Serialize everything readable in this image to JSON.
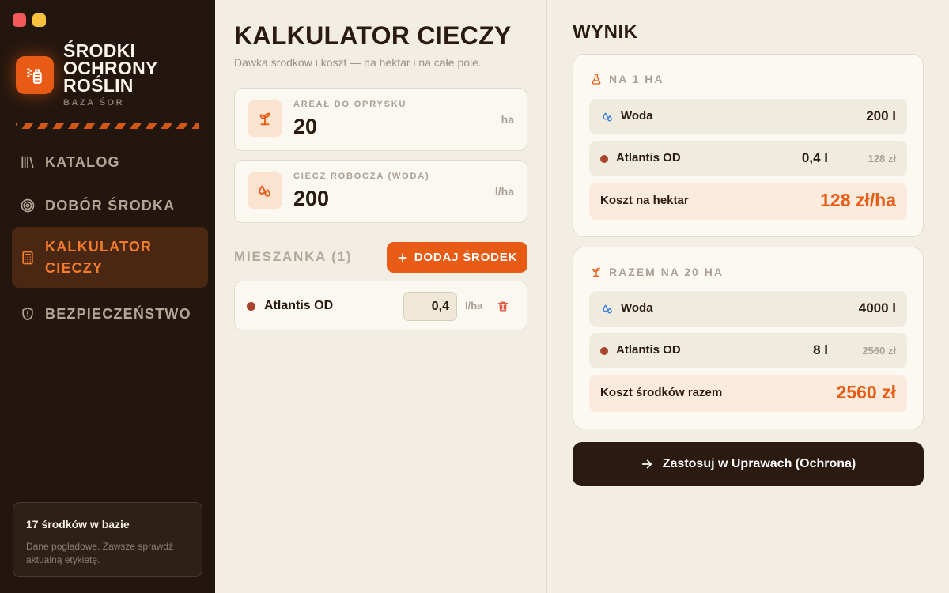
{
  "app": {
    "title": "ŚRODKI OCHRONY ROŚLIN",
    "subtitle": "BAZA ŚOR"
  },
  "nav": {
    "items": [
      {
        "label": "KATALOG",
        "icon": "library-icon",
        "active": false
      },
      {
        "label": "DOBÓR ŚRODKA",
        "icon": "target-icon",
        "active": false
      },
      {
        "label": "KALKULATOR CIECZY",
        "icon": "calculator-icon",
        "active": true
      },
      {
        "label": "BEZPIECZEŃSTWO",
        "icon": "shield-alert-icon",
        "active": false
      }
    ]
  },
  "info": {
    "title": "17 środków w bazie",
    "text": "Dane poglądowe. Zawsze sprawdź aktualną etykietę."
  },
  "calculator": {
    "title": "KALKULATOR CIECZY",
    "subtitle": "Dawka środków i koszt — na hektar i na całe pole.",
    "area": {
      "label": "AREAŁ DO OPRYSKU",
      "value": "20",
      "unit": "ha"
    },
    "water": {
      "label": "CIECZ ROBOCZA (WODA)",
      "value": "200",
      "unit": "l/ha"
    },
    "mix": {
      "title": "MIESZANKA (1)",
      "add_label": "DODAJ ŚRODEK",
      "items": [
        {
          "name": "Atlantis OD",
          "dose": "0,4",
          "unit": "l/ha",
          "color": "#a8452c"
        }
      ]
    }
  },
  "result": {
    "title": "WYNIK",
    "per_ha": {
      "heading": "NA 1 HA",
      "water_label": "Woda",
      "water_value": "200 l",
      "product_name": "Atlantis OD",
      "product_value": "0,4 l",
      "product_cost": "128 zł",
      "total_label": "Koszt na hektar",
      "total_value": "128 zł/ha"
    },
    "total": {
      "heading": "RAZEM NA 20 HA",
      "water_label": "Woda",
      "water_value": "4000 l",
      "product_name": "Atlantis OD",
      "product_value": "8 l",
      "product_cost": "2560 zł",
      "total_label": "Koszt środków razem",
      "total_value": "2560 zł"
    },
    "apply_label": "Zastosuj w Uprawach (Ochrona)"
  },
  "colors": {
    "accent": "#e85b14",
    "sidebar": "#23160e",
    "background": "#f3eee3",
    "product": "#a8452c"
  }
}
